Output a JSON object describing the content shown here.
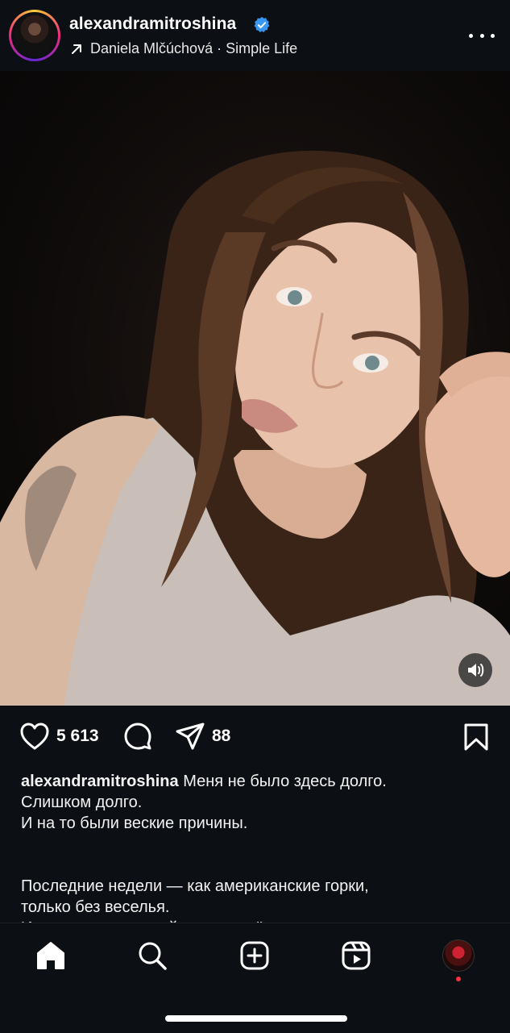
{
  "header": {
    "username": "alexandramitroshina",
    "subtitle": "Daniela Mlčúchová · Simple Life"
  },
  "actions": {
    "likes": "5 613",
    "shares": "88"
  },
  "caption": {
    "username": "alexandramitroshina",
    "lines": [
      "Меня не было здесь долго.",
      "Слишком долго.",
      "И на то были веские причины.",
      "Последние недели — как американские горки,",
      "только без веселья.",
      "История с налоговой отняла всё: время, энергию,"
    ]
  },
  "icons": {
    "verified": "verified-badge-icon",
    "more": "more-options-icon",
    "like": "heart-icon",
    "comment": "comment-icon",
    "share": "send-icon",
    "save": "bookmark-icon",
    "sound": "speaker-icon",
    "nav": [
      "home-icon",
      "search-icon",
      "create-icon",
      "reels-icon",
      "profile-avatar"
    ]
  },
  "colors": {
    "background": "#0c0f14",
    "verified": "#3897f0",
    "notification": "#ff3040"
  }
}
